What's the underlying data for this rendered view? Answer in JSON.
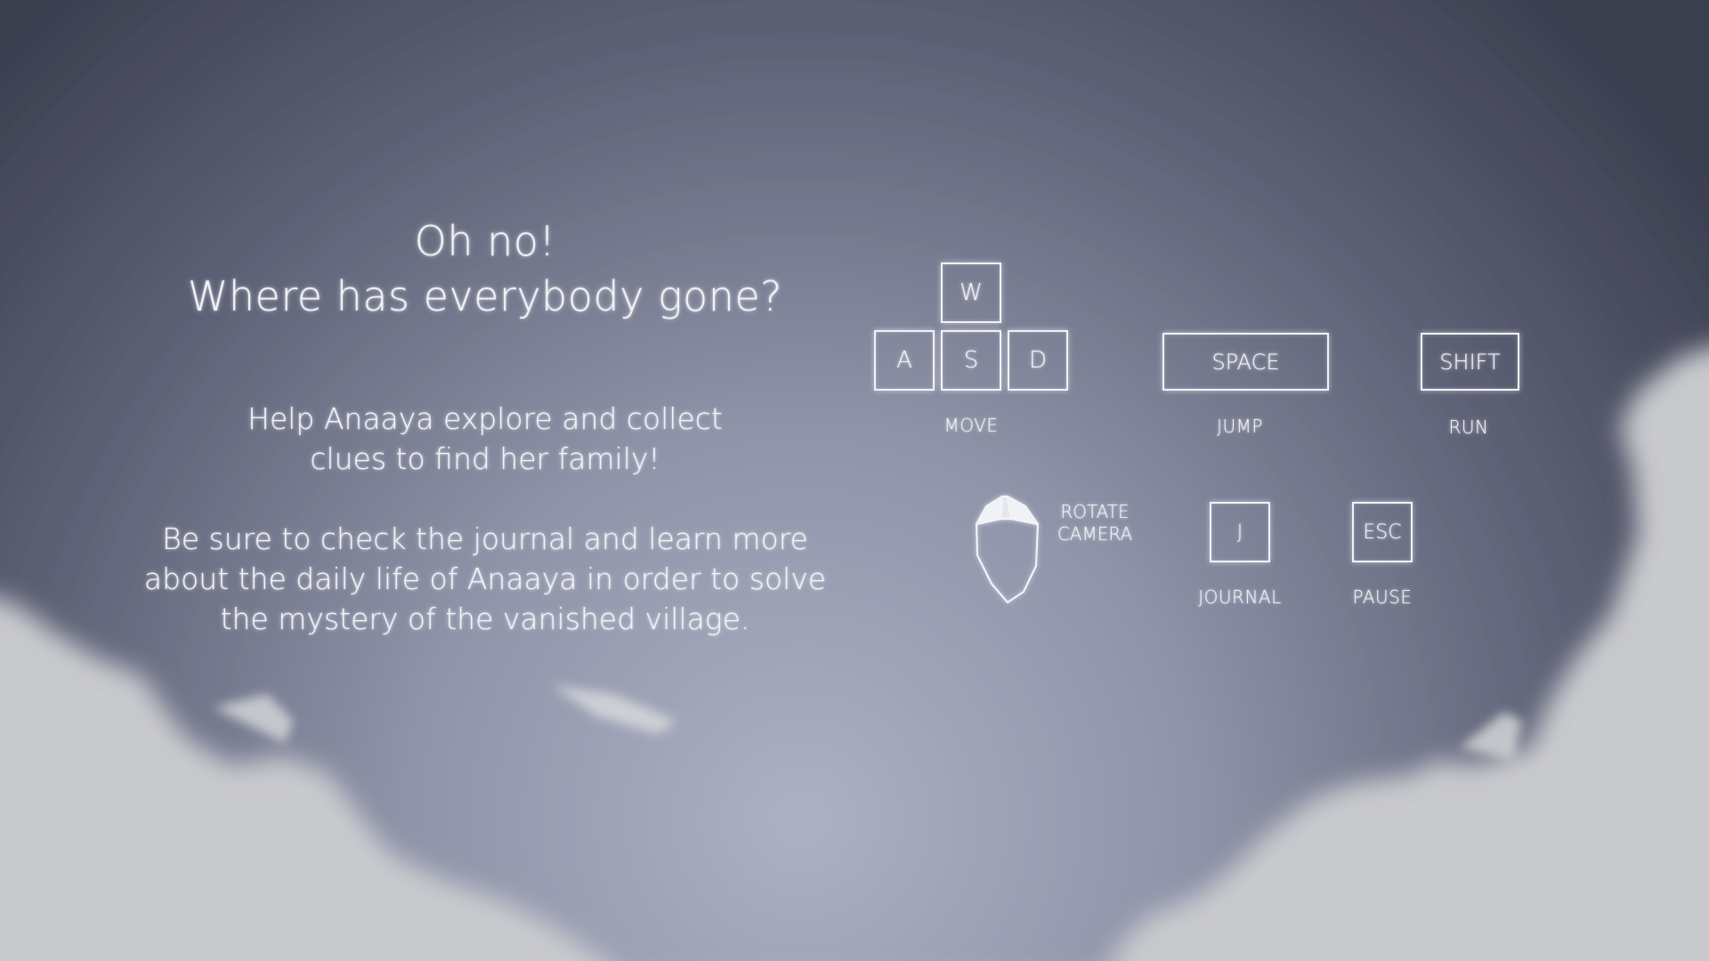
{
  "intro": {
    "title_line1": "Oh no!",
    "title_line2": "Where has everybody gone?",
    "paragraph1_line1": "Help Anaaya explore and collect",
    "paragraph1_line2": "clues to find her family!",
    "paragraph2_line1": "Be sure to check the journal and learn more",
    "paragraph2_line2": "about the daily life of Anaaya in order to solve",
    "paragraph2_line3": "the mystery of the vanished village."
  },
  "controls": {
    "move": {
      "keys": [
        "W",
        "A",
        "S",
        "D"
      ],
      "label": "MOVE"
    },
    "jump": {
      "key": "SPACE",
      "label": "JUMP"
    },
    "run": {
      "key": "SHIFT",
      "label": "RUN"
    },
    "camera": {
      "icon": "mouse-icon",
      "label_line1": "ROTATE",
      "label_line2": "CAMERA"
    },
    "journal": {
      "key": "J",
      "label": "JOURNAL"
    },
    "pause": {
      "key": "ESC",
      "label": "PAUSE"
    }
  },
  "colors": {
    "backdrop_dark": "#3d4152",
    "backdrop_light": "#a7abbd",
    "ground": "#c9cace",
    "text_glow": "#f2f3f8"
  }
}
